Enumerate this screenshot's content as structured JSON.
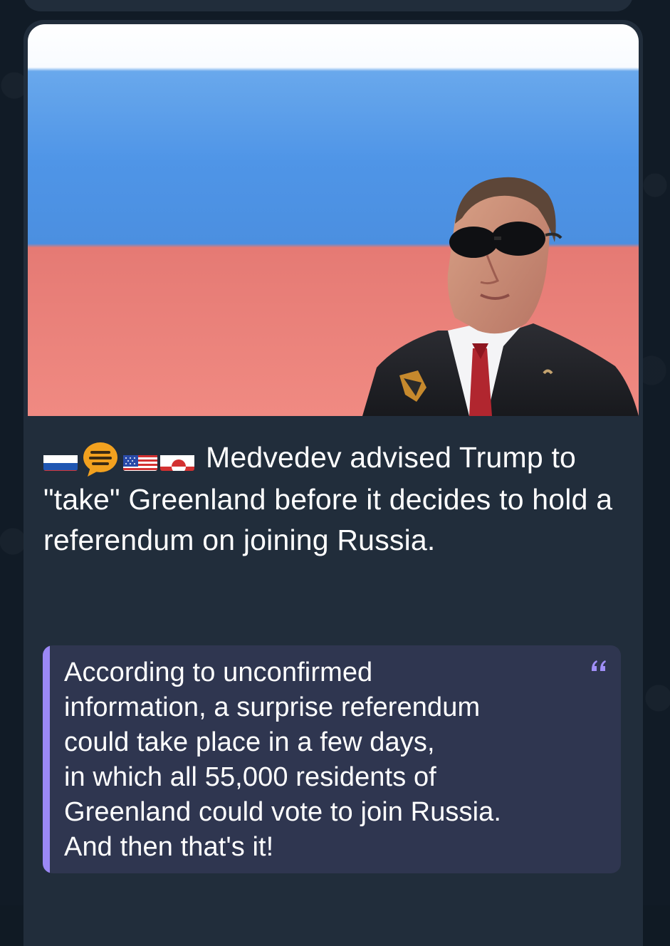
{
  "post": {
    "image_alt_icon": "news-photo",
    "emoji_icons": [
      "russia-flag-icon",
      "speech-bubble-icon",
      "us-flag-icon",
      "greenland-flag-icon"
    ],
    "headline": "Medvedev advised Trump to \"take\" Greenland before it decides to hold a referendum on joining Russia.",
    "quote_lines": [
      "According to unconfirmed",
      "information, a surprise referendum",
      "could take place in a few days,",
      "in which all 55,000 residents of",
      "Greenland could vote to join Russia.",
      "And then that's it!"
    ]
  },
  "colors": {
    "background": "#111b26",
    "bubble": "#212d3b",
    "quote_background": "#2f3650",
    "quote_accent": "#9b88f5",
    "text": "#ffffff"
  }
}
